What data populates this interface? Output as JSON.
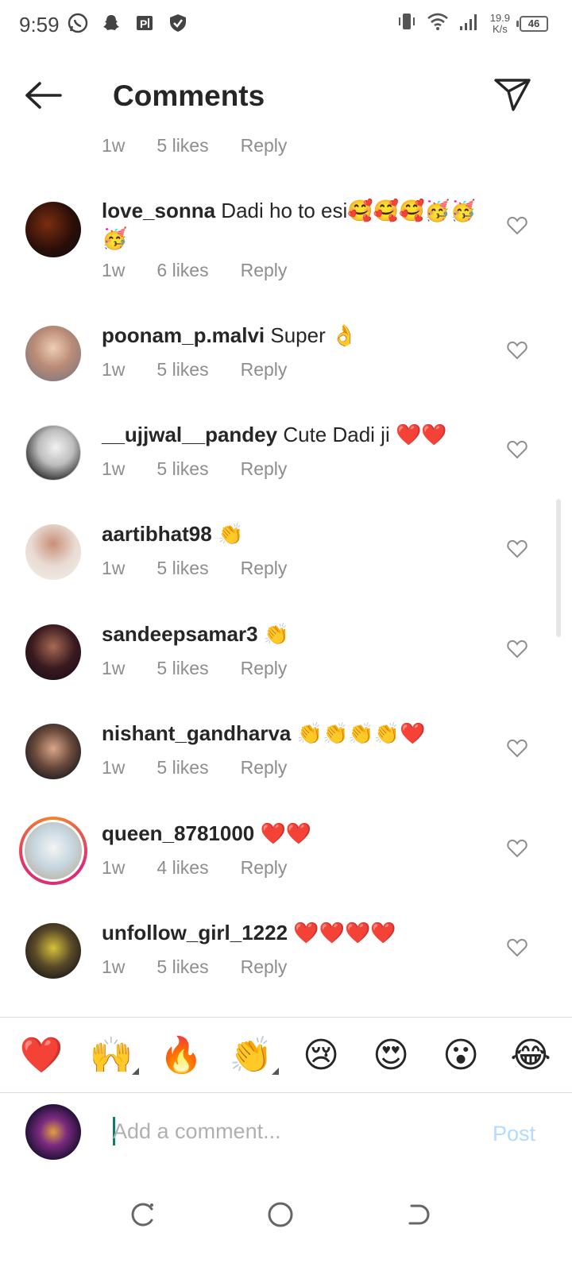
{
  "status_bar": {
    "time": "9:59",
    "net_speed_value": "19.9",
    "net_speed_unit": "K/s",
    "battery": "46",
    "icons": [
      "whatsapp-icon",
      "snapchat-icon",
      "parking-app-icon",
      "shield-icon",
      "vibrate-icon",
      "wifi-icon",
      "signal-icon"
    ]
  },
  "header": {
    "title": "Comments"
  },
  "top_partial": {
    "time": "1w",
    "likes": "5 likes",
    "reply": "Reply"
  },
  "comments": [
    {
      "user": "love_sonna",
      "text": " Dadi ho to esi",
      "emoji": "🥰🥰🥰🥳🥳🥳",
      "time": "1w",
      "likes": "6 likes",
      "reply": "Reply"
    },
    {
      "user": "poonam_p.malvi",
      "text": " Super ",
      "emoji": "👌",
      "time": "1w",
      "likes": "5 likes",
      "reply": "Reply"
    },
    {
      "user": "__ujjwal__pandey",
      "text": " Cute Dadi ji ",
      "emoji": "❤️❤️",
      "time": "1w",
      "likes": "5 likes",
      "reply": "Reply"
    },
    {
      "user": "aartibhat98",
      "text": " ",
      "emoji": "👏",
      "time": "1w",
      "likes": "5 likes",
      "reply": "Reply"
    },
    {
      "user": "sandeepsamar3",
      "text": " ",
      "emoji": "👏",
      "time": "1w",
      "likes": "5 likes",
      "reply": "Reply"
    },
    {
      "user": "nishant_gandharva",
      "text": " ",
      "emoji": "👏👏👏👏❤️",
      "time": "1w",
      "likes": "5 likes",
      "reply": "Reply"
    },
    {
      "user": "queen_8781000",
      "text": " ",
      "emoji": "❤️❤️",
      "time": "1w",
      "likes": "4 likes",
      "reply": "Reply"
    },
    {
      "user": "unfollow_girl_1222",
      "text": " ",
      "emoji": "❤️❤️❤️❤️",
      "time": "1w",
      "likes": "5 likes",
      "reply": "Reply"
    }
  ],
  "quick_emojis": [
    "❤️",
    "🙌",
    "🔥",
    "👏",
    "😢",
    "😍",
    "😮",
    "😂"
  ],
  "input": {
    "placeholder": "Add a comment...",
    "post_label": "Post"
  },
  "colors": {
    "accent_disabled": "#b3dbff",
    "meta_text": "#8e8e8e",
    "heart_red": "#ed4956"
  }
}
